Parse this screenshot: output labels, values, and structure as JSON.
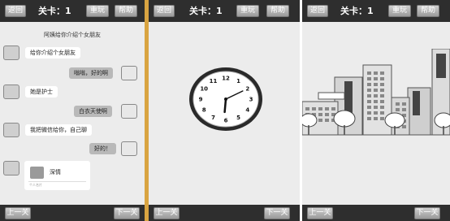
{
  "panels": [
    {
      "back_label": "返回",
      "level_label": "关卡：1",
      "restart_label": "重玩",
      "help_label": "帮助",
      "prev_label": "上一关",
      "next_label": "下一关",
      "chat": {
        "title": "阿姨给你介绍个女朋友",
        "messages": [
          {
            "side": "left",
            "text": "给你介绍个女朋友"
          },
          {
            "side": "right",
            "text": "嗡嗡，好的啊"
          },
          {
            "side": "left",
            "text": "她是护士"
          },
          {
            "side": "right",
            "text": "白衣天使啊"
          },
          {
            "side": "left",
            "text": "我把微信给你，自己聊"
          },
          {
            "side": "right",
            "text": "好的！"
          }
        ],
        "card": {
          "title": "深情",
          "subtitle": "个人名片"
        }
      }
    },
    {
      "back_label": "返回",
      "level_label": "关卡：1",
      "restart_label": "重玩",
      "help_label": "帮助",
      "prev_label": "上一关",
      "next_label": "下一关",
      "clock": {
        "numbers": [
          "12",
          "1",
          "2",
          "3",
          "4",
          "5",
          "6",
          "7",
          "8",
          "9",
          "10",
          "11"
        ],
        "hour": 6,
        "minute": 10
      }
    },
    {
      "back_label": "返回",
      "level_label": "关卡：1",
      "restart_label": "重玩",
      "help_label": "帮助",
      "prev_label": "上一关",
      "next_label": "下一关"
    }
  ],
  "colors": {
    "bar": "#2e2e2e",
    "accent_divider": "#d9a441",
    "bubble_right": "#b9b9b9"
  }
}
